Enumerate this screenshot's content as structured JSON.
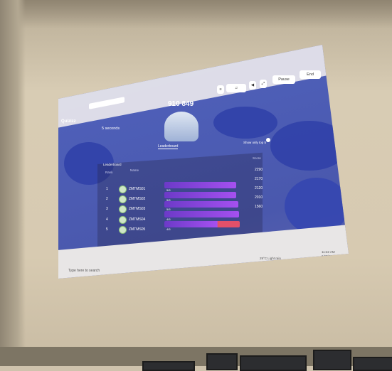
{
  "app": {
    "name": "Quizizz"
  },
  "header": {
    "score_caption": "",
    "score": "910 849",
    "pause_label": "Pause",
    "end_label": "End"
  },
  "left_panel": {
    "label": "5 seconds"
  },
  "tabs": [
    {
      "label": "Leaderboard",
      "active": true
    },
    {
      "label": "",
      "active": false
    }
  ],
  "toggle_label": "Show only top 5",
  "table": {
    "title": "Leaderboard",
    "columns": [
      "Rank",
      "Name",
      "Score"
    ],
    "rows": [
      {
        "rank": "1",
        "name": "ZMTMS01",
        "bar": 0.86,
        "bar_label": "5/5",
        "score": "2290"
      },
      {
        "rank": "2",
        "name": "ZMTMS02",
        "bar": 0.86,
        "bar_label": "5/5",
        "score": "2170"
      },
      {
        "rank": "3",
        "name": "ZMTMS03",
        "bar": 0.88,
        "bar_label": "5/5",
        "score": "2120"
      },
      {
        "rank": "4",
        "name": "ZMTMS04",
        "bar": 0.89,
        "bar_label": "4/5",
        "score": "2010"
      },
      {
        "rank": "5",
        "name": "ZMTMS05",
        "bar": 0.9,
        "bar_label": "4/5",
        "score": "1560"
      }
    ]
  },
  "taskbar": {
    "search_placeholder": "Type here to search",
    "weather": "29°C  Light rain",
    "time": "11:22 AM",
    "date": "6/15/2022"
  },
  "colors": {
    "bar": "#8a45e0",
    "bar_wrong": "#e2506a",
    "background": "#4e5fb8"
  }
}
